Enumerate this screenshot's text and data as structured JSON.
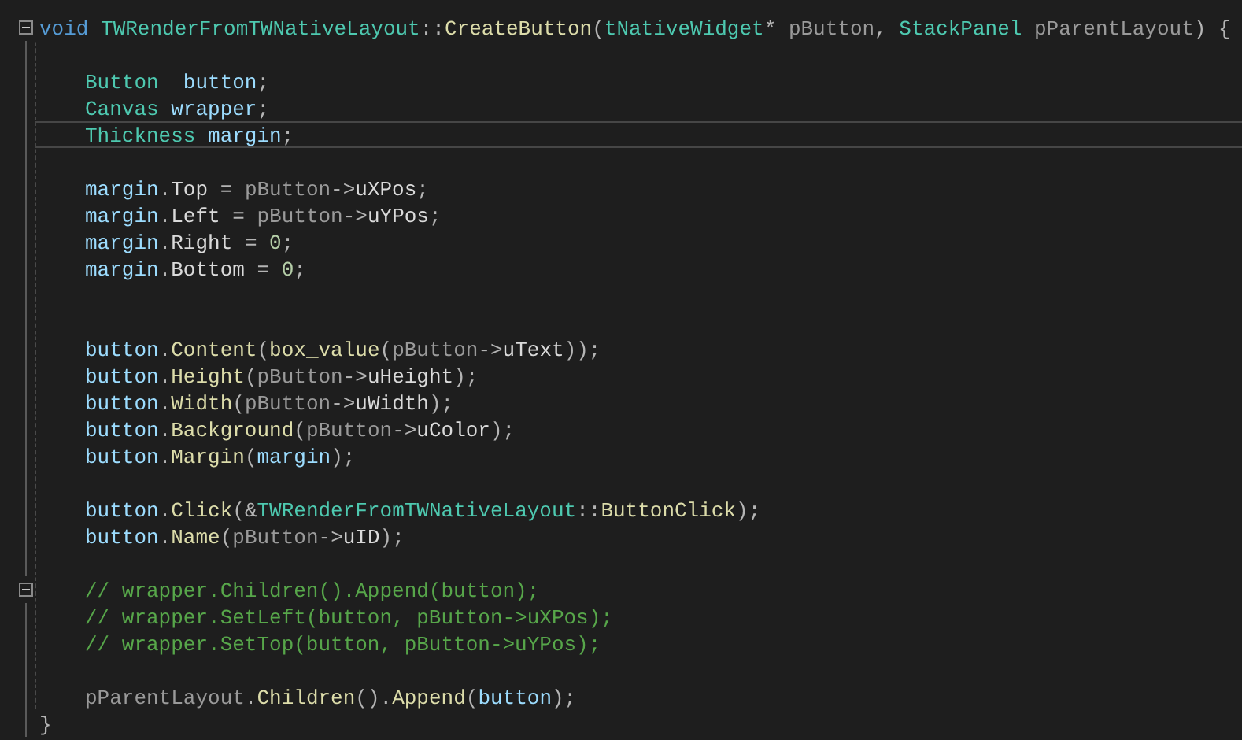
{
  "editor": {
    "lines": [
      {
        "indented": false,
        "current": false,
        "fold": true,
        "tokens": [
          {
            "text": "void",
            "kind": "keyword"
          },
          {
            "text": " TWRenderFromTWNativeLayout",
            "kind": "type"
          },
          {
            "text": "::",
            "kind": "punct"
          },
          {
            "text": "CreateButton",
            "kind": "func"
          },
          {
            "text": "(",
            "kind": "punct"
          },
          {
            "text": "tNativeWidget",
            "kind": "type"
          },
          {
            "text": "* ",
            "kind": "punct"
          },
          {
            "text": "pButton",
            "kind": "param"
          },
          {
            "text": ", ",
            "kind": "punct"
          },
          {
            "text": "StackPanel",
            "kind": "type"
          },
          {
            "text": " pParentLayout",
            "kind": "param"
          },
          {
            "text": ") {",
            "kind": "punct"
          }
        ]
      },
      {
        "indented": true,
        "current": false,
        "fold": false
      },
      {
        "indented": true,
        "current": false,
        "fold": false,
        "tokens": [
          {
            "text": "Button",
            "kind": "type"
          },
          {
            "text": "  button",
            "kind": "var"
          },
          {
            "text": ";",
            "kind": "punct"
          }
        ]
      },
      {
        "indented": true,
        "current": false,
        "fold": false,
        "tokens": [
          {
            "text": "Canvas",
            "kind": "type"
          },
          {
            "text": " wrapper",
            "kind": "var"
          },
          {
            "text": ";",
            "kind": "punct"
          }
        ]
      },
      {
        "indented": true,
        "current": true,
        "fold": false,
        "tokens": [
          {
            "text": "Thickness",
            "kind": "type"
          },
          {
            "text": " margin",
            "kind": "var"
          },
          {
            "text": ";",
            "kind": "punct"
          }
        ]
      },
      {
        "indented": true,
        "current": false,
        "fold": false
      },
      {
        "indented": true,
        "current": false,
        "fold": false,
        "tokens": [
          {
            "text": "margin",
            "kind": "var"
          },
          {
            "text": ".",
            "kind": "punct"
          },
          {
            "text": "Top",
            "kind": "member"
          },
          {
            "text": " = ",
            "kind": "punct"
          },
          {
            "text": "pButton",
            "kind": "param"
          },
          {
            "text": "->",
            "kind": "punct"
          },
          {
            "text": "uXPos",
            "kind": "member"
          },
          {
            "text": ";",
            "kind": "punct"
          }
        ]
      },
      {
        "indented": true,
        "current": false,
        "fold": false,
        "tokens": [
          {
            "text": "margin",
            "kind": "var"
          },
          {
            "text": ".",
            "kind": "punct"
          },
          {
            "text": "Left",
            "kind": "member"
          },
          {
            "text": " = ",
            "kind": "punct"
          },
          {
            "text": "pButton",
            "kind": "param"
          },
          {
            "text": "->",
            "kind": "punct"
          },
          {
            "text": "uYPos",
            "kind": "member"
          },
          {
            "text": ";",
            "kind": "punct"
          }
        ]
      },
      {
        "indented": true,
        "current": false,
        "fold": false,
        "tokens": [
          {
            "text": "margin",
            "kind": "var"
          },
          {
            "text": ".",
            "kind": "punct"
          },
          {
            "text": "Right",
            "kind": "member"
          },
          {
            "text": " = ",
            "kind": "punct"
          },
          {
            "text": "0",
            "kind": "number"
          },
          {
            "text": ";",
            "kind": "punct"
          }
        ]
      },
      {
        "indented": true,
        "current": false,
        "fold": false,
        "tokens": [
          {
            "text": "margin",
            "kind": "var"
          },
          {
            "text": ".",
            "kind": "punct"
          },
          {
            "text": "Bottom",
            "kind": "member"
          },
          {
            "text": " = ",
            "kind": "punct"
          },
          {
            "text": "0",
            "kind": "number"
          },
          {
            "text": ";",
            "kind": "punct"
          }
        ]
      },
      {
        "indented": true,
        "current": false,
        "fold": false
      },
      {
        "indented": true,
        "current": false,
        "fold": false
      },
      {
        "indented": true,
        "current": false,
        "fold": false,
        "tokens": [
          {
            "text": "button",
            "kind": "var"
          },
          {
            "text": ".",
            "kind": "punct"
          },
          {
            "text": "Content",
            "kind": "func"
          },
          {
            "text": "(",
            "kind": "punct"
          },
          {
            "text": "box_value",
            "kind": "func"
          },
          {
            "text": "(",
            "kind": "punct"
          },
          {
            "text": "pButton",
            "kind": "param"
          },
          {
            "text": "->",
            "kind": "punct"
          },
          {
            "text": "uText",
            "kind": "member"
          },
          {
            "text": "));",
            "kind": "punct"
          }
        ]
      },
      {
        "indented": true,
        "current": false,
        "fold": false,
        "tokens": [
          {
            "text": "button",
            "kind": "var"
          },
          {
            "text": ".",
            "kind": "punct"
          },
          {
            "text": "Height",
            "kind": "func"
          },
          {
            "text": "(",
            "kind": "punct"
          },
          {
            "text": "pButton",
            "kind": "param"
          },
          {
            "text": "->",
            "kind": "punct"
          },
          {
            "text": "uHeight",
            "kind": "member"
          },
          {
            "text": ");",
            "kind": "punct"
          }
        ]
      },
      {
        "indented": true,
        "current": false,
        "fold": false,
        "tokens": [
          {
            "text": "button",
            "kind": "var"
          },
          {
            "text": ".",
            "kind": "punct"
          },
          {
            "text": "Width",
            "kind": "func"
          },
          {
            "text": "(",
            "kind": "punct"
          },
          {
            "text": "pButton",
            "kind": "param"
          },
          {
            "text": "->",
            "kind": "punct"
          },
          {
            "text": "uWidth",
            "kind": "member"
          },
          {
            "text": ");",
            "kind": "punct"
          }
        ]
      },
      {
        "indented": true,
        "current": false,
        "fold": false,
        "tokens": [
          {
            "text": "button",
            "kind": "var"
          },
          {
            "text": ".",
            "kind": "punct"
          },
          {
            "text": "Background",
            "kind": "func"
          },
          {
            "text": "(",
            "kind": "punct"
          },
          {
            "text": "pButton",
            "kind": "param"
          },
          {
            "text": "->",
            "kind": "punct"
          },
          {
            "text": "uColor",
            "kind": "member"
          },
          {
            "text": ");",
            "kind": "punct"
          }
        ]
      },
      {
        "indented": true,
        "current": false,
        "fold": false,
        "tokens": [
          {
            "text": "button",
            "kind": "var"
          },
          {
            "text": ".",
            "kind": "punct"
          },
          {
            "text": "Margin",
            "kind": "func"
          },
          {
            "text": "(",
            "kind": "punct"
          },
          {
            "text": "margin",
            "kind": "var"
          },
          {
            "text": ");",
            "kind": "punct"
          }
        ]
      },
      {
        "indented": true,
        "current": false,
        "fold": false
      },
      {
        "indented": true,
        "current": false,
        "fold": false,
        "tokens": [
          {
            "text": "button",
            "kind": "var"
          },
          {
            "text": ".",
            "kind": "punct"
          },
          {
            "text": "Click",
            "kind": "func"
          },
          {
            "text": "(&",
            "kind": "punct"
          },
          {
            "text": "TWRenderFromTWNativeLayout",
            "kind": "type"
          },
          {
            "text": "::",
            "kind": "punct"
          },
          {
            "text": "ButtonClick",
            "kind": "func"
          },
          {
            "text": ");",
            "kind": "punct"
          }
        ]
      },
      {
        "indented": true,
        "current": false,
        "fold": false,
        "tokens": [
          {
            "text": "button",
            "kind": "var"
          },
          {
            "text": ".",
            "kind": "punct"
          },
          {
            "text": "Name",
            "kind": "func"
          },
          {
            "text": "(",
            "kind": "punct"
          },
          {
            "text": "pButton",
            "kind": "param"
          },
          {
            "text": "->",
            "kind": "punct"
          },
          {
            "text": "uID",
            "kind": "member"
          },
          {
            "text": ");",
            "kind": "punct"
          }
        ]
      },
      {
        "indented": true,
        "current": false,
        "fold": false
      },
      {
        "indented": true,
        "current": false,
        "fold": true,
        "tokens": [
          {
            "text": "// wrapper.Children().Append(button);",
            "kind": "comment"
          }
        ]
      },
      {
        "indented": true,
        "current": false,
        "fold": false,
        "tokens": [
          {
            "text": "// wrapper.SetLeft(button, pButton->uXPos);",
            "kind": "comment"
          }
        ]
      },
      {
        "indented": true,
        "current": false,
        "fold": false,
        "tokens": [
          {
            "text": "// wrapper.SetTop(button, pButton->uYPos);",
            "kind": "comment"
          }
        ]
      },
      {
        "indented": true,
        "current": false,
        "fold": false
      },
      {
        "indented": true,
        "current": false,
        "fold": false,
        "tokens": [
          {
            "text": "pParentLayout",
            "kind": "param"
          },
          {
            "text": ".",
            "kind": "punct"
          },
          {
            "text": "Children",
            "kind": "func"
          },
          {
            "text": "().",
            "kind": "punct"
          },
          {
            "text": "Append",
            "kind": "func"
          },
          {
            "text": "(",
            "kind": "punct"
          },
          {
            "text": "button",
            "kind": "var"
          },
          {
            "text": ");",
            "kind": "punct"
          }
        ]
      },
      {
        "indented": false,
        "current": false,
        "fold": false,
        "tokens": [
          {
            "text": "}",
            "kind": "punct"
          }
        ]
      }
    ]
  }
}
